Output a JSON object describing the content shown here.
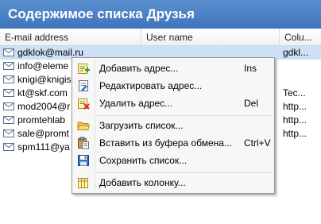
{
  "window": {
    "title": "Содержимое списка Друзья"
  },
  "table": {
    "columns": [
      "E-mail address",
      "User name",
      "Colu..."
    ],
    "rows": [
      {
        "email": "gdklok@mail.ru",
        "user": "",
        "extra": "gdkl...",
        "selected": true
      },
      {
        "email": "info@eleme",
        "user": "",
        "extra": ""
      },
      {
        "email": "knigi@knigis",
        "user": "",
        "extra": ""
      },
      {
        "email": "kt@skf.com",
        "user": "",
        "extra": "Tec..."
      },
      {
        "email": "mod2004@r",
        "user": "",
        "extra": "http..."
      },
      {
        "email": "promtehlab",
        "user": "",
        "extra": "http..."
      },
      {
        "email": "sale@promt",
        "user": "",
        "extra": "http..."
      },
      {
        "email": "spm111@ya",
        "user": "",
        "extra": ""
      }
    ]
  },
  "context_menu": {
    "items": [
      {
        "label": "Добавить адрес...",
        "shortcut": "Ins",
        "icon": "add-address-icon"
      },
      {
        "label": "Редактировать адрес...",
        "shortcut": "",
        "icon": "edit-address-icon"
      },
      {
        "label": "Удалить адрес...",
        "shortcut": "Del",
        "icon": "delete-address-icon"
      },
      {
        "label": "Загрузить список...",
        "shortcut": "",
        "icon": "open-folder-icon"
      },
      {
        "label": "Вставить из буфера обмена...",
        "shortcut": "Ctrl+V",
        "icon": "paste-clipboard-icon"
      },
      {
        "label": "Сохранить список...",
        "shortcut": "",
        "icon": "save-floppy-icon"
      },
      {
        "label": "Добавить колонку...",
        "shortcut": "",
        "icon": "add-column-icon"
      }
    ]
  }
}
